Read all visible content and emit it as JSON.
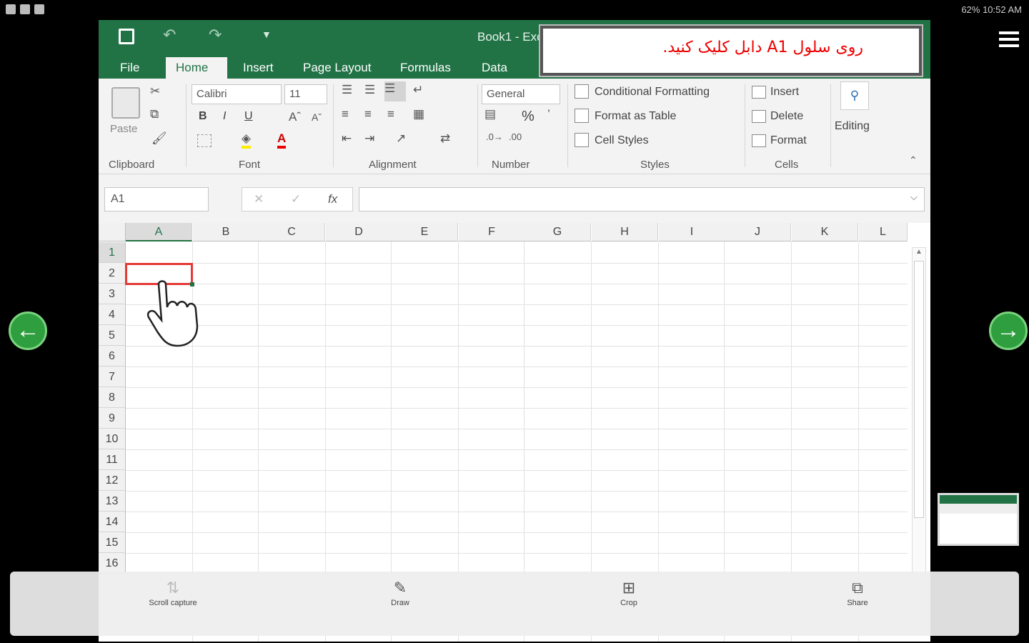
{
  "status_bar": {
    "right_text": "62% 10:52 AM"
  },
  "title_bar": {
    "title": "Book1 - Exc"
  },
  "instruction": {
    "text": "روی سلول A1 دابل کلیک کنید."
  },
  "tabs": [
    "File",
    "Home",
    "Insert",
    "Page Layout",
    "Formulas",
    "Data"
  ],
  "ribbon": {
    "paste_label": "Paste",
    "font_name": "Calibri",
    "font_size": "11",
    "bold": "B",
    "italic": "I",
    "underline": "U",
    "number_format": "General",
    "percent": "%",
    "conditional_formatting": "Conditional Formatting",
    "format_as_table": "Format as Table",
    "cell_styles": "Cell Styles",
    "insert": "Insert",
    "delete": "Delete",
    "format": "Format",
    "editing": "Editing",
    "groups": {
      "clipboard": "Clipboard",
      "font": "Font",
      "alignment": "Alignment",
      "number": "Number",
      "styles": "Styles",
      "cells": "Cells"
    }
  },
  "formula_bar": {
    "name_box": "A1",
    "fx": "fx",
    "formula": ""
  },
  "columns": [
    "A",
    "B",
    "C",
    "D",
    "E",
    "F",
    "G",
    "H",
    "I",
    "J",
    "K",
    "L"
  ],
  "rows": [
    "1",
    "2",
    "3",
    "4",
    "5",
    "6",
    "7",
    "8",
    "9",
    "10",
    "11",
    "12",
    "13",
    "14",
    "15",
    "16"
  ],
  "bottom_toolbar": {
    "scroll_capture": "Scroll capture",
    "draw": "Draw",
    "crop": "Crop",
    "share": "Share"
  },
  "colors": {
    "excel_green": "#217346",
    "selection_red": "#e53935",
    "nav_green": "#2e9e3e"
  }
}
